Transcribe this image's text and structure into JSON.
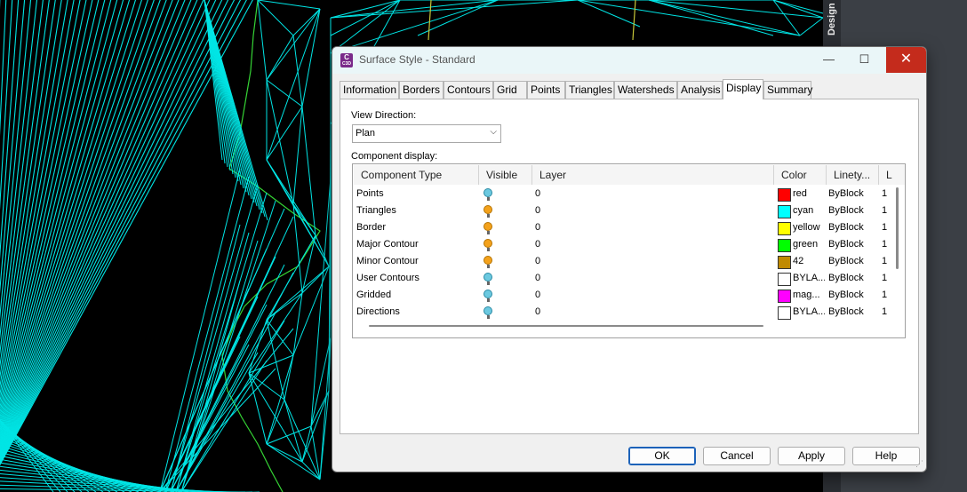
{
  "side_panel": {
    "label": "Design"
  },
  "dialog": {
    "title": "Surface Style - Standard",
    "app_icon": {
      "letter": "C",
      "sub": "C3D"
    },
    "window_buttons": {
      "minimize": "—",
      "maximize": "☐",
      "close": "✕"
    },
    "tabs": [
      "Information",
      "Borders",
      "Contours",
      "Grid",
      "Points",
      "Triangles",
      "Watersheds",
      "Analysis",
      "Display",
      "Summary"
    ],
    "active_tab": "Display",
    "view_direction": {
      "label": "View Direction:",
      "value": "Plan"
    },
    "component_display": {
      "label": "Component display:",
      "columns": [
        "Component Type",
        "Visible",
        "Layer",
        "Color",
        "Linety...",
        "L"
      ],
      "rows": [
        {
          "type": "Points",
          "visible": false,
          "layer": "0",
          "color_name": "red",
          "color": "#ff0000",
          "linetype": "ByBlock",
          "lw": "1"
        },
        {
          "type": "Triangles",
          "visible": true,
          "layer": "0",
          "color_name": "cyan",
          "color": "#00ffff",
          "linetype": "ByBlock",
          "lw": "1"
        },
        {
          "type": "Border",
          "visible": true,
          "layer": "0",
          "color_name": "yellow",
          "color": "#ffff00",
          "linetype": "ByBlock",
          "lw": "1"
        },
        {
          "type": "Major Contour",
          "visible": true,
          "layer": "0",
          "color_name": "green",
          "color": "#00ff00",
          "linetype": "ByBlock",
          "lw": "1"
        },
        {
          "type": "Minor Contour",
          "visible": true,
          "layer": "0",
          "color_name": "42",
          "color": "#c08a00",
          "linetype": "ByBlock",
          "lw": "1"
        },
        {
          "type": "User Contours",
          "visible": false,
          "layer": "0",
          "color_name": "BYLA...",
          "color": "#ffffff",
          "linetype": "ByBlock",
          "lw": "1"
        },
        {
          "type": "Gridded",
          "visible": false,
          "layer": "0",
          "color_name": "mag...",
          "color": "#ff00ff",
          "linetype": "ByBlock",
          "lw": "1"
        },
        {
          "type": "Directions",
          "visible": false,
          "layer": "0",
          "color_name": "BYLA...",
          "color": "#ffffff",
          "linetype": "ByBlock",
          "lw": "1"
        }
      ]
    },
    "buttons": {
      "ok": "OK",
      "cancel": "Cancel",
      "apply": "Apply",
      "help": "Help"
    }
  }
}
